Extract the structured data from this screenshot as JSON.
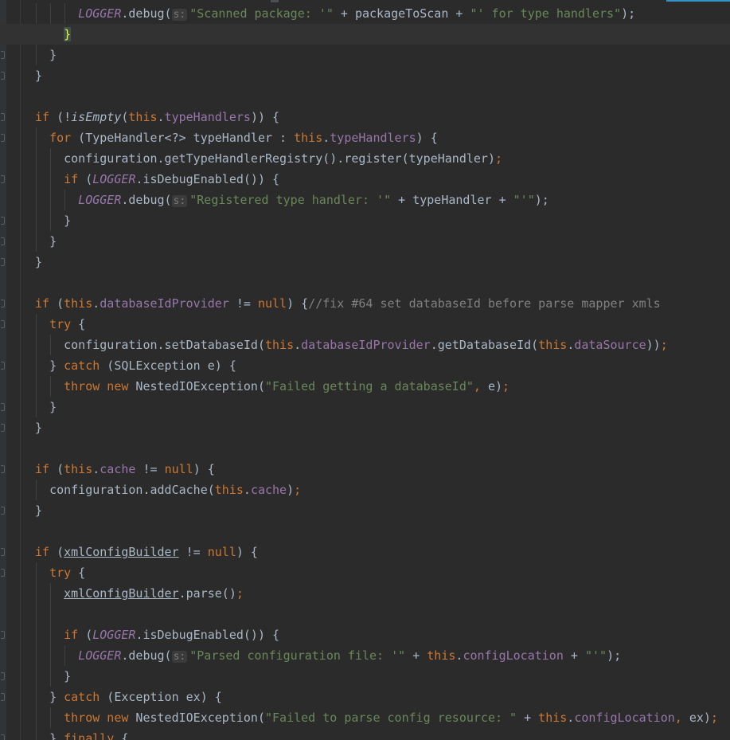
{
  "editor": {
    "language": "java",
    "indent_unit": "  ",
    "current_line": 1,
    "colors": {
      "background": "#2b2b2b",
      "plain": "#a9b7c6",
      "keyword": "#cc7832",
      "string": "#6a8759",
      "field": "#9876aa",
      "comment": "#808080",
      "brace_match": "#ffef28"
    },
    "lines": [
      {
        "indent": 3,
        "segs": [
          {
            "t": "LOGGER",
            "c": "static"
          },
          {
            "t": ".debug(",
            "c": "plain"
          },
          {
            "t": "s:",
            "c": "hint"
          },
          {
            "t": "\"Scanned package: '\"",
            "c": "str"
          },
          {
            "t": " + packageToScan + ",
            "c": "plain"
          },
          {
            "t": "\"' for type handlers\"",
            "c": "str"
          },
          {
            "t": ");",
            "c": "plain"
          }
        ]
      },
      {
        "indent": 2,
        "segs": [
          {
            "t": "}",
            "c": "match"
          }
        ]
      },
      {
        "indent": 1,
        "segs": [
          {
            "t": "}",
            "c": "plain"
          }
        ]
      },
      {
        "indent": 0,
        "segs": [
          {
            "t": "}",
            "c": "plain"
          }
        ]
      },
      {
        "indent": 0,
        "segs": []
      },
      {
        "indent": 0,
        "segs": [
          {
            "t": "if",
            "c": "kw"
          },
          {
            "t": " (!",
            "c": "plain"
          },
          {
            "t": "isEmpty",
            "c": "staticm"
          },
          {
            "t": "(",
            "c": "plain"
          },
          {
            "t": "this",
            "c": "kw"
          },
          {
            "t": ".",
            "c": "plain"
          },
          {
            "t": "typeHandlers",
            "c": "field"
          },
          {
            "t": ")) {",
            "c": "plain"
          }
        ]
      },
      {
        "indent": 1,
        "segs": [
          {
            "t": "for",
            "c": "kw"
          },
          {
            "t": " (TypeHandler<?> typeHandler : ",
            "c": "plain"
          },
          {
            "t": "this",
            "c": "kw"
          },
          {
            "t": ".",
            "c": "plain"
          },
          {
            "t": "typeHandlers",
            "c": "field"
          },
          {
            "t": ") {",
            "c": "plain"
          }
        ]
      },
      {
        "indent": 2,
        "segs": [
          {
            "t": "configuration.getTypeHandlerRegistry().register(typeHandler)",
            "c": "plain"
          },
          {
            "t": ";",
            "c": "punct"
          }
        ]
      },
      {
        "indent": 2,
        "segs": [
          {
            "t": "if",
            "c": "kw"
          },
          {
            "t": " (",
            "c": "plain"
          },
          {
            "t": "LOGGER",
            "c": "static"
          },
          {
            "t": ".isDebugEnabled()) {",
            "c": "plain"
          }
        ]
      },
      {
        "indent": 3,
        "segs": [
          {
            "t": "LOGGER",
            "c": "static"
          },
          {
            "t": ".debug(",
            "c": "plain"
          },
          {
            "t": "s:",
            "c": "hint"
          },
          {
            "t": "\"Registered type handler: '\"",
            "c": "str"
          },
          {
            "t": " + typeHandler + ",
            "c": "plain"
          },
          {
            "t": "\"'\"",
            "c": "str"
          },
          {
            "t": ");",
            "c": "plain"
          }
        ]
      },
      {
        "indent": 2,
        "segs": [
          {
            "t": "}",
            "c": "plain"
          }
        ]
      },
      {
        "indent": 1,
        "segs": [
          {
            "t": "}",
            "c": "plain"
          }
        ]
      },
      {
        "indent": 0,
        "segs": [
          {
            "t": "}",
            "c": "plain"
          }
        ]
      },
      {
        "indent": 0,
        "segs": []
      },
      {
        "indent": 0,
        "segs": [
          {
            "t": "if",
            "c": "kw"
          },
          {
            "t": " (",
            "c": "plain"
          },
          {
            "t": "this",
            "c": "kw"
          },
          {
            "t": ".",
            "c": "plain"
          },
          {
            "t": "databaseIdProvider",
            "c": "field"
          },
          {
            "t": " != ",
            "c": "plain"
          },
          {
            "t": "null",
            "c": "kw"
          },
          {
            "t": ") {",
            "c": "plain"
          },
          {
            "t": "//fix #64 set databaseId before parse mapper xmls",
            "c": "comment"
          }
        ]
      },
      {
        "indent": 1,
        "segs": [
          {
            "t": "try",
            "c": "kw"
          },
          {
            "t": " {",
            "c": "plain"
          }
        ]
      },
      {
        "indent": 2,
        "segs": [
          {
            "t": "configuration.setDatabaseId(",
            "c": "plain"
          },
          {
            "t": "this",
            "c": "kw"
          },
          {
            "t": ".",
            "c": "plain"
          },
          {
            "t": "databaseIdProvider",
            "c": "field"
          },
          {
            "t": ".getDatabaseId(",
            "c": "plain"
          },
          {
            "t": "this",
            "c": "kw"
          },
          {
            "t": ".",
            "c": "plain"
          },
          {
            "t": "dataSource",
            "c": "field"
          },
          {
            "t": "))",
            "c": "plain"
          },
          {
            "t": ";",
            "c": "punct"
          }
        ]
      },
      {
        "indent": 1,
        "segs": [
          {
            "t": "} ",
            "c": "plain"
          },
          {
            "t": "catch",
            "c": "kw"
          },
          {
            "t": " (SQLException e) {",
            "c": "plain"
          }
        ]
      },
      {
        "indent": 2,
        "segs": [
          {
            "t": "throw new",
            "c": "kw"
          },
          {
            "t": " NestedIOException(",
            "c": "plain"
          },
          {
            "t": "\"Failed getting a databaseId\"",
            "c": "str"
          },
          {
            "t": ", ",
            "c": "punct"
          },
          {
            "t": "e)",
            "c": "plain"
          },
          {
            "t": ";",
            "c": "punct"
          }
        ]
      },
      {
        "indent": 1,
        "segs": [
          {
            "t": "}",
            "c": "plain"
          }
        ]
      },
      {
        "indent": 0,
        "segs": [
          {
            "t": "}",
            "c": "plain"
          }
        ]
      },
      {
        "indent": 0,
        "segs": []
      },
      {
        "indent": 0,
        "segs": [
          {
            "t": "if",
            "c": "kw"
          },
          {
            "t": " (",
            "c": "plain"
          },
          {
            "t": "this",
            "c": "kw"
          },
          {
            "t": ".",
            "c": "plain"
          },
          {
            "t": "cache",
            "c": "field"
          },
          {
            "t": " != ",
            "c": "plain"
          },
          {
            "t": "null",
            "c": "kw"
          },
          {
            "t": ") {",
            "c": "plain"
          }
        ]
      },
      {
        "indent": 1,
        "segs": [
          {
            "t": "configuration.addCache(",
            "c": "plain"
          },
          {
            "t": "this",
            "c": "kw"
          },
          {
            "t": ".",
            "c": "plain"
          },
          {
            "t": "cache",
            "c": "field"
          },
          {
            "t": ")",
            "c": "plain"
          },
          {
            "t": ";",
            "c": "punct"
          }
        ]
      },
      {
        "indent": 0,
        "segs": [
          {
            "t": "}",
            "c": "plain"
          }
        ]
      },
      {
        "indent": 0,
        "segs": []
      },
      {
        "indent": 0,
        "segs": [
          {
            "t": "if",
            "c": "kw"
          },
          {
            "t": " (",
            "c": "plain"
          },
          {
            "t": "xmlConfigBuilder",
            "c": "uline"
          },
          {
            "t": " != ",
            "c": "plain"
          },
          {
            "t": "null",
            "c": "kw"
          },
          {
            "t": ") {",
            "c": "plain"
          }
        ]
      },
      {
        "indent": 1,
        "segs": [
          {
            "t": "try",
            "c": "kw"
          },
          {
            "t": " {",
            "c": "plain"
          }
        ]
      },
      {
        "indent": 2,
        "segs": [
          {
            "t": "xmlConfigBuilder",
            "c": "uline"
          },
          {
            "t": ".parse()",
            "c": "plain"
          },
          {
            "t": ";",
            "c": "punct"
          }
        ]
      },
      {
        "indent": 0,
        "segs": []
      },
      {
        "indent": 2,
        "segs": [
          {
            "t": "if",
            "c": "kw"
          },
          {
            "t": " (",
            "c": "plain"
          },
          {
            "t": "LOGGER",
            "c": "static"
          },
          {
            "t": ".isDebugEnabled()) {",
            "c": "plain"
          }
        ]
      },
      {
        "indent": 3,
        "segs": [
          {
            "t": "LOGGER",
            "c": "static"
          },
          {
            "t": ".debug(",
            "c": "plain"
          },
          {
            "t": "s:",
            "c": "hint"
          },
          {
            "t": "\"Parsed configuration file: '\"",
            "c": "str"
          },
          {
            "t": " + ",
            "c": "plain"
          },
          {
            "t": "this",
            "c": "kw"
          },
          {
            "t": ".",
            "c": "plain"
          },
          {
            "t": "configLocation",
            "c": "field"
          },
          {
            "t": " + ",
            "c": "plain"
          },
          {
            "t": "\"'\"",
            "c": "str"
          },
          {
            "t": ");",
            "c": "plain"
          }
        ]
      },
      {
        "indent": 2,
        "segs": [
          {
            "t": "}",
            "c": "plain"
          }
        ]
      },
      {
        "indent": 1,
        "segs": [
          {
            "t": "} ",
            "c": "plain"
          },
          {
            "t": "catch",
            "c": "kw"
          },
          {
            "t": " (Exception ex) {",
            "c": "plain"
          }
        ]
      },
      {
        "indent": 2,
        "segs": [
          {
            "t": "throw new",
            "c": "kw"
          },
          {
            "t": " NestedIOException(",
            "c": "plain"
          },
          {
            "t": "\"Failed to parse config resource: \"",
            "c": "str"
          },
          {
            "t": " + ",
            "c": "plain"
          },
          {
            "t": "this",
            "c": "kw"
          },
          {
            "t": ".",
            "c": "plain"
          },
          {
            "t": "configLocation",
            "c": "field"
          },
          {
            "t": ", ",
            "c": "punct"
          },
          {
            "t": "ex)",
            "c": "plain"
          },
          {
            "t": ";",
            "c": "punct"
          }
        ]
      },
      {
        "indent": 1,
        "segs": [
          {
            "t": "} ",
            "c": "plain"
          },
          {
            "t": "finally",
            "c": "kw"
          },
          {
            "t": " {",
            "c": "plain"
          }
        ]
      }
    ]
  }
}
